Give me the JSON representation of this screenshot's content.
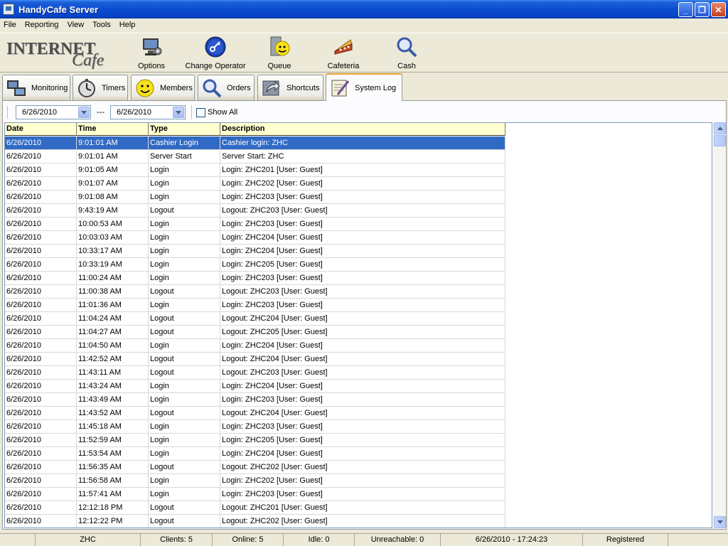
{
  "window": {
    "title": "HandyCafe Server",
    "minimize": "_",
    "maximize": "❐",
    "close": "✕"
  },
  "menu": [
    "File",
    "Reporting",
    "View",
    "Tools",
    "Help"
  ],
  "logo": {
    "line1": "INTERNET",
    "line2": "Cafe"
  },
  "toolbar": {
    "options": "Options",
    "change_operator": "Change Operator",
    "queue": "Queue",
    "cafeteria": "Cafeteria",
    "cash": "Cash"
  },
  "tabs": {
    "monitoring": "Monitoring",
    "timers": "Timers",
    "members": "Members",
    "orders": "Orders",
    "shortcuts": "Shortcuts",
    "system_log": "System Log"
  },
  "filter": {
    "date_from": "6/26/2010",
    "separator": "---",
    "date_to": "6/26/2010",
    "show_all_label": "Show All",
    "show_all_checked": false
  },
  "log_table": {
    "columns": [
      "Date",
      "Time",
      "Type",
      "Description"
    ],
    "selected_row": 0,
    "rows": [
      [
        "6/26/2010",
        "9:01:01 AM",
        "Cashier Login",
        "Cashier login: ZHC"
      ],
      [
        "6/26/2010",
        "9:01:01 AM",
        "Server Start",
        "Server Start: ZHC"
      ],
      [
        "6/26/2010",
        "9:01:05 AM",
        "Login",
        "Login: ZHC201 [User: Guest]"
      ],
      [
        "6/26/2010",
        "9:01:07 AM",
        "Login",
        "Login: ZHC202 [User: Guest]"
      ],
      [
        "6/26/2010",
        "9:01:08 AM",
        "Login",
        "Login: ZHC203 [User: Guest]"
      ],
      [
        "6/26/2010",
        "9:43:19 AM",
        "Logout",
        "Logout: ZHC203 [User: Guest]"
      ],
      [
        "6/26/2010",
        "10:00:53 AM",
        "Login",
        "Login: ZHC203 [User: Guest]"
      ],
      [
        "6/26/2010",
        "10:03:03 AM",
        "Login",
        "Login: ZHC204 [User: Guest]"
      ],
      [
        "6/26/2010",
        "10:33:17 AM",
        "Login",
        "Login: ZHC204 [User: Guest]"
      ],
      [
        "6/26/2010",
        "10:33:19 AM",
        "Login",
        "Login: ZHC205 [User: Guest]"
      ],
      [
        "6/26/2010",
        "11:00:24 AM",
        "Login",
        "Login: ZHC203 [User: Guest]"
      ],
      [
        "6/26/2010",
        "11:00:38 AM",
        "Logout",
        "Logout: ZHC203 [User: Guest]"
      ],
      [
        "6/26/2010",
        "11:01:36 AM",
        "Login",
        "Login: ZHC203 [User: Guest]"
      ],
      [
        "6/26/2010",
        "11:04:24 AM",
        "Logout",
        "Logout: ZHC204 [User: Guest]"
      ],
      [
        "6/26/2010",
        "11:04:27 AM",
        "Logout",
        "Logout: ZHC205 [User: Guest]"
      ],
      [
        "6/26/2010",
        "11:04:50 AM",
        "Login",
        "Login: ZHC204 [User: Guest]"
      ],
      [
        "6/26/2010",
        "11:42:52 AM",
        "Logout",
        "Logout: ZHC204 [User: Guest]"
      ],
      [
        "6/26/2010",
        "11:43:11 AM",
        "Logout",
        "Logout: ZHC203 [User: Guest]"
      ],
      [
        "6/26/2010",
        "11:43:24 AM",
        "Login",
        "Login: ZHC204 [User: Guest]"
      ],
      [
        "6/26/2010",
        "11:43:49 AM",
        "Login",
        "Login: ZHC203 [User: Guest]"
      ],
      [
        "6/26/2010",
        "11:43:52 AM",
        "Logout",
        "Logout: ZHC204 [User: Guest]"
      ],
      [
        "6/26/2010",
        "11:45:18 AM",
        "Login",
        "Login: ZHC203 [User: Guest]"
      ],
      [
        "6/26/2010",
        "11:52:59 AM",
        "Login",
        "Login: ZHC205 [User: Guest]"
      ],
      [
        "6/26/2010",
        "11:53:54 AM",
        "Login",
        "Login: ZHC204 [User: Guest]"
      ],
      [
        "6/26/2010",
        "11:56:35 AM",
        "Logout",
        "Logout: ZHC202 [User: Guest]"
      ],
      [
        "6/26/2010",
        "11:56:58 AM",
        "Login",
        "Login: ZHC202 [User: Guest]"
      ],
      [
        "6/26/2010",
        "11:57:41 AM",
        "Login",
        "Login: ZHC203 [User: Guest]"
      ],
      [
        "6/26/2010",
        "12:12:18 PM",
        "Logout",
        "Logout: ZHC201 [User: Guest]"
      ],
      [
        "6/26/2010",
        "12:12:22 PM",
        "Logout",
        "Logout: ZHC202 [User: Guest]"
      ]
    ]
  },
  "status": {
    "operator": "ZHC",
    "clients": "Clients: 5",
    "online": "Online: 5",
    "idle": "Idle: 0",
    "unreachable": "Unreachable: 0",
    "datetime": "6/26/2010 - 17:24:23",
    "registration": "Registered"
  },
  "colors": {
    "selection": "#316ac5",
    "header_bg": "#ffffd0",
    "titlebar": "#0a4dd1",
    "active_tab_accent": "#e6a032"
  }
}
